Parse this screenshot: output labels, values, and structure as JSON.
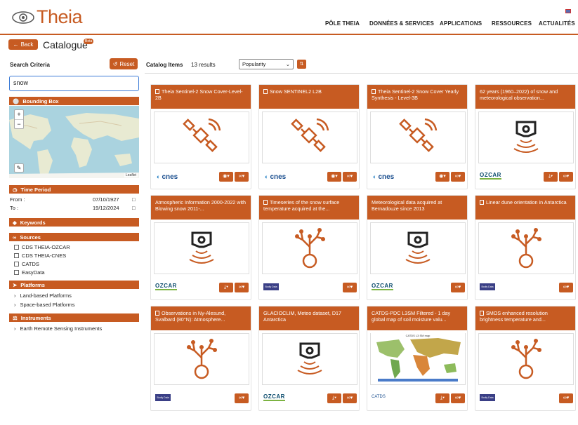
{
  "header": {
    "brand": "Theia",
    "nav": [
      "PÔLE THEIA",
      "DONNÉES & SERVICES",
      "APPLICATIONS",
      "RESSOURCES",
      "ACTUALITÉS"
    ]
  },
  "toolbar": {
    "back_label": "Back",
    "page_title": "Catalogue",
    "beta_badge": "Beta"
  },
  "search_criteria": {
    "title": "Search Criteria",
    "reset_label": "Reset",
    "search_value": "snow",
    "bounding_box_label": "Bounding Box",
    "map_attribution": "Leaflet",
    "time_period_label": "Time Period",
    "from_label": "From :",
    "from_value": "07/10/1927",
    "to_label": "To :",
    "to_value": "19/12/2024",
    "keywords_label": "Keywords",
    "sources_label": "Sources",
    "sources": [
      "CDS THEIA-OZCAR",
      "CDS THEIA-CNES",
      "CATDS",
      "EasyData"
    ],
    "platforms_label": "Platforms",
    "platforms": [
      "Land-based Platforms",
      "Space-based Platforms"
    ],
    "instruments_label": "Instruments",
    "instruments": [
      "Earth Remote Sensing Instruments"
    ]
  },
  "catalog": {
    "title": "Catalog Items",
    "results": "13 results",
    "sort_value": "Popularity",
    "items": [
      {
        "title": "Theia Sentinel-2 Snow Cover-Level-2B",
        "icon": "satellite-icon",
        "logo": "cnes"
      },
      {
        "title": "Snow SENTINEL2 L2B",
        "icon": "satellite-icon",
        "logo": "cnes"
      },
      {
        "title": "Theia Sentinel-2 Snow Cover Yearly Synthesis - Level-3B",
        "icon": "satellite-icon",
        "logo": "cnes"
      },
      {
        "title": "62 years (1960–2022) of snow and meteorological observation...",
        "icon": "sensor-icon",
        "logo": "ozcar"
      },
      {
        "title": "Atmospheric Information 2000-2022 with Blowing snow 2011-...",
        "icon": "sensor-icon",
        "logo": "ozcar"
      },
      {
        "title": "Timeseries of the snow surface temperature acquired at the...",
        "icon": "tree-icon",
        "logo": "bg"
      },
      {
        "title": "Meteorological data acquired at Bernadouze since 2013",
        "icon": "sensor-icon",
        "logo": "ozcar"
      },
      {
        "title": "Linear dune orientation in Antarctica",
        "icon": "tree-icon",
        "logo": "bg"
      },
      {
        "title": "Observations in Ny-Alesund, Svalbard (80°N): Atmosphere...",
        "icon": "tree-icon",
        "logo": "bg"
      },
      {
        "title": "GLACIOCLIM, Meteo dataset, D17 Antarctica",
        "icon": "sensor-icon",
        "logo": "ozcar"
      },
      {
        "title": "CATDS-PDC L3SM Filtered - 1 day global map of soil moisture valu...",
        "icon": "map-thumbnail",
        "logo": "catds"
      },
      {
        "title": "SMOS enhanced resolution brightness temperature and...",
        "icon": "tree-icon",
        "logo": "bg"
      }
    ]
  },
  "logos": {
    "cnes": "cnes",
    "ozcar": "OZCAR",
    "bg": "Bodly Data",
    "catds": "CATDS"
  },
  "colors": {
    "accent": "#c75b22",
    "map_water": "#aad3df",
    "map_land": "#e8ead2"
  }
}
